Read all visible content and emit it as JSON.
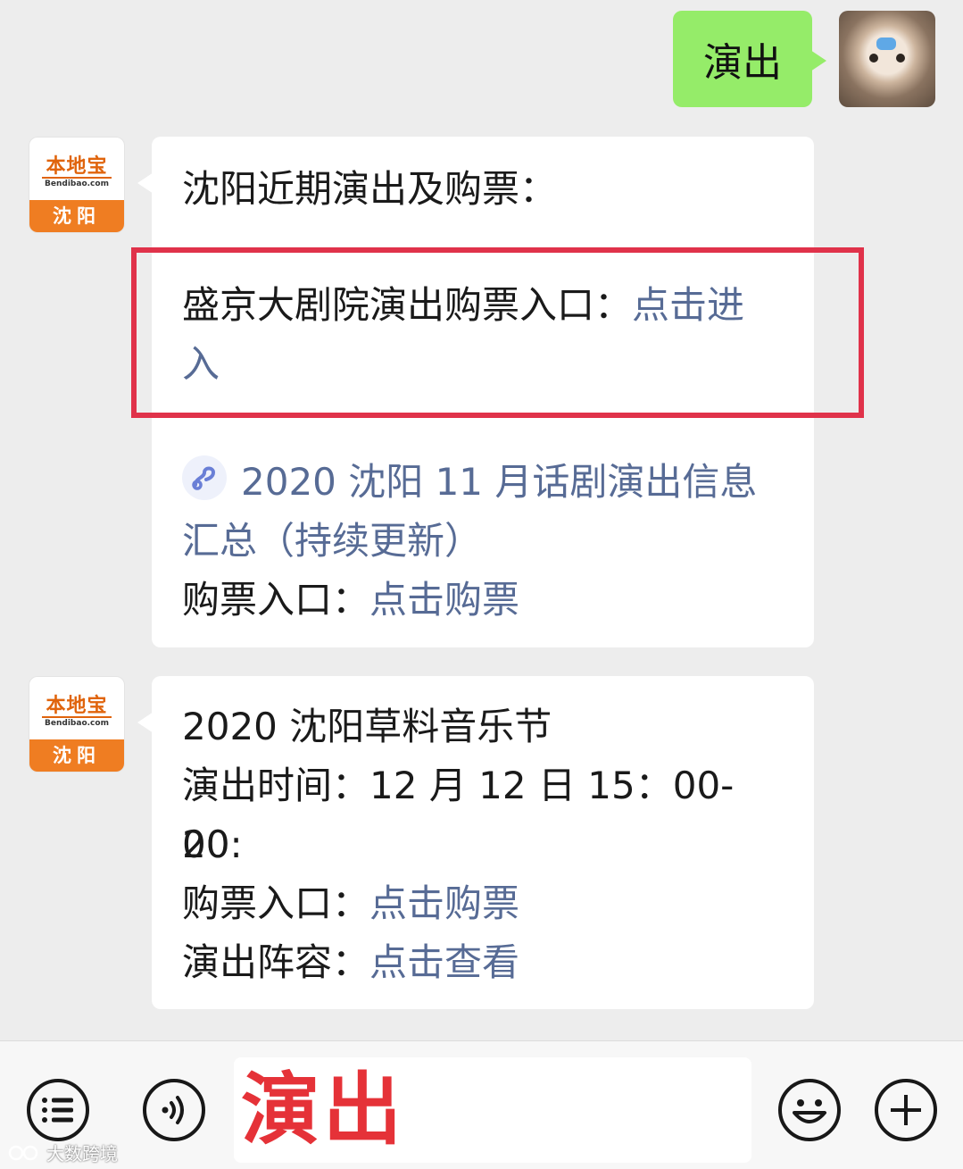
{
  "outgoing": {
    "text": "演出"
  },
  "account": {
    "brand": "本地宝",
    "domain": "Bendibao.com",
    "city": "沈阳"
  },
  "message1": {
    "heading": "沈阳近期演出及购票：",
    "item1_label": "盛京大剧院演出购票入口：",
    "item1_link_a": "点击进",
    "item1_link_b": "入",
    "miniprogram_icon": "mini-program-link-icon",
    "item2_title_a": "2020 沈阳 11 月话剧演出信息",
    "item2_title_b": "汇总（持续更新）",
    "item2_label": "购票入口：",
    "item2_link": "点击购票"
  },
  "message2": {
    "title": "2020 沈阳草料音乐节",
    "time_line_a": "演出时间：12 月 12 日 15：00-20:",
    "time_line_b": "00",
    "ticket_label": "购票入口：",
    "ticket_link": "点击购票",
    "lineup_label": "演出阵容：",
    "lineup_link": "点击查看"
  },
  "toolbar": {
    "input_value": "演出",
    "icons": [
      "menu-list-icon",
      "voice-icon",
      "emoji-icon",
      "plus-icon"
    ]
  },
  "watermark": {
    "text": "大数跨境"
  },
  "colors": {
    "outgoing_bubble": "#95ec69",
    "link": "#576b95",
    "highlight": "#e0324a",
    "input_text": "#e53238"
  }
}
